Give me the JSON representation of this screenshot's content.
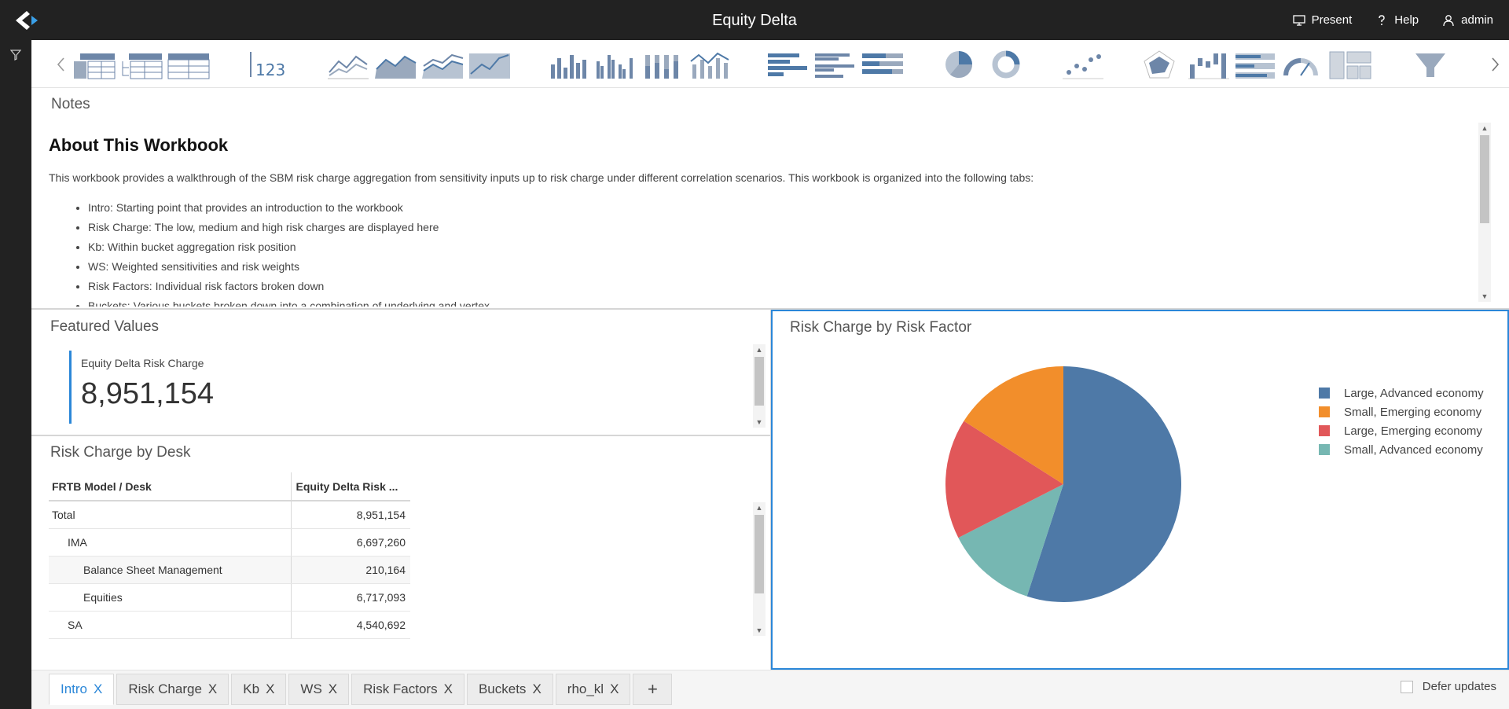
{
  "app": {
    "title": "Equity Delta"
  },
  "header": {
    "actions": [
      {
        "label": "Present",
        "icon": "monitor-icon"
      },
      {
        "label": "Help",
        "icon": "help-icon"
      },
      {
        "label": "admin",
        "icon": "user-icon"
      }
    ]
  },
  "toolbar": {
    "widgets": [
      "pivot-table-icon",
      "tree-table-icon",
      "table-icon",
      "kpi-icon",
      "line-chart-icon",
      "area-chart-icon",
      "stacked-area-icon",
      "area-fill-icon",
      "column-chart-icon",
      "clustered-column-icon",
      "stacked-column-icon",
      "combo-chart-icon",
      "bar-chart-icon",
      "clustered-bar-icon",
      "stacked-bar-icon",
      "pie-chart-icon",
      "donut-chart-icon",
      "scatter-chart-icon",
      "radar-chart-icon",
      "waterfall-chart-icon",
      "bullet-chart-icon",
      "gauge-icon",
      "layout-icon",
      "funnel-icon"
    ]
  },
  "notes": {
    "title": "Notes",
    "heading": "About This Workbook",
    "intro": "This workbook provides a walkthrough of the SBM risk charge aggregation from sensitivity inputs up to risk charge under different correlation scenarios. This workbook is organized into the following tabs:",
    "items": [
      "Intro: Starting point that provides an introduction to the workbook",
      "Risk Charge: The low, medium and high risk charges are displayed here",
      "Kb: Within bucket aggregation risk position",
      "WS: Weighted sensitivities and risk weights",
      "Risk Factors: Individual risk factors broken down",
      "Buckets: Various buckets broken down into a combination of underlying and vertex"
    ]
  },
  "featured": {
    "title": "Featured Values",
    "kpi_label": "Equity Delta Risk Charge",
    "kpi_value": "8,951,154"
  },
  "desk": {
    "title": "Risk Charge by Desk",
    "columns": [
      "FRTB Model / Desk",
      "Equity Delta Risk ..."
    ],
    "rows": [
      {
        "label": "Total",
        "value": "8,951,154"
      },
      {
        "label": "IMA",
        "value": "6,697,260"
      },
      {
        "label": "Balance Sheet Management",
        "value": "210,164"
      },
      {
        "label": "Equities",
        "value": "6,717,093"
      },
      {
        "label": "SA",
        "value": "4,540,692"
      }
    ]
  },
  "chart": {
    "title": "Risk Charge by Risk Factor"
  },
  "chart_data": {
    "type": "pie",
    "title": "Risk Charge by Risk Factor",
    "categories": [
      "Large, Advanced economy",
      "Small, Emerging economy",
      "Large, Emerging economy",
      "Small, Advanced economy"
    ],
    "values": [
      55.0,
      16.0,
      16.5,
      12.5
    ],
    "colors": [
      "#4e79a7",
      "#f28e2b",
      "#e15759",
      "#76b7b2"
    ],
    "slice_order": [
      0,
      3,
      2,
      1
    ],
    "legend": "top-right"
  },
  "tabs": {
    "items": [
      "Intro",
      "Risk Charge",
      "Kb",
      "WS",
      "Risk Factors",
      "Buckets",
      "rho_kl"
    ],
    "active": "Intro",
    "close_glyph": "X",
    "add_glyph": "+"
  },
  "defer": {
    "label": "Defer updates"
  }
}
